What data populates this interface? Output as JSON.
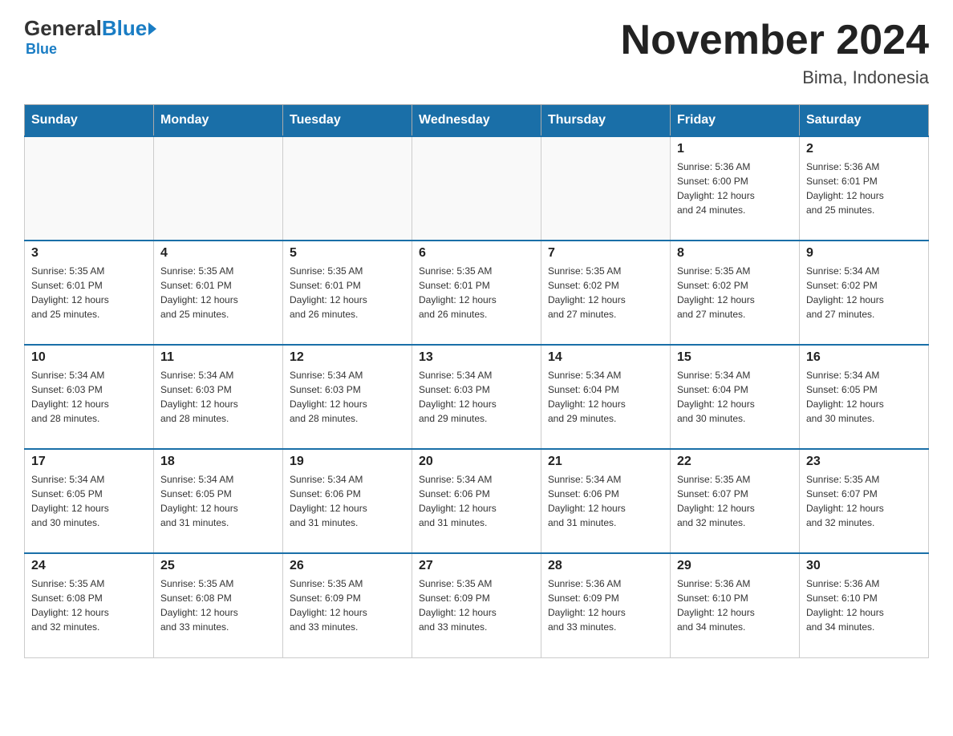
{
  "header": {
    "logo_general": "General",
    "logo_blue": "Blue",
    "title": "November 2024",
    "subtitle": "Bima, Indonesia"
  },
  "days_of_week": [
    "Sunday",
    "Monday",
    "Tuesday",
    "Wednesday",
    "Thursday",
    "Friday",
    "Saturday"
  ],
  "weeks": [
    [
      {
        "day": "",
        "info": ""
      },
      {
        "day": "",
        "info": ""
      },
      {
        "day": "",
        "info": ""
      },
      {
        "day": "",
        "info": ""
      },
      {
        "day": "",
        "info": ""
      },
      {
        "day": "1",
        "info": "Sunrise: 5:36 AM\nSunset: 6:00 PM\nDaylight: 12 hours\nand 24 minutes."
      },
      {
        "day": "2",
        "info": "Sunrise: 5:36 AM\nSunset: 6:01 PM\nDaylight: 12 hours\nand 25 minutes."
      }
    ],
    [
      {
        "day": "3",
        "info": "Sunrise: 5:35 AM\nSunset: 6:01 PM\nDaylight: 12 hours\nand 25 minutes."
      },
      {
        "day": "4",
        "info": "Sunrise: 5:35 AM\nSunset: 6:01 PM\nDaylight: 12 hours\nand 25 minutes."
      },
      {
        "day": "5",
        "info": "Sunrise: 5:35 AM\nSunset: 6:01 PM\nDaylight: 12 hours\nand 26 minutes."
      },
      {
        "day": "6",
        "info": "Sunrise: 5:35 AM\nSunset: 6:01 PM\nDaylight: 12 hours\nand 26 minutes."
      },
      {
        "day": "7",
        "info": "Sunrise: 5:35 AM\nSunset: 6:02 PM\nDaylight: 12 hours\nand 27 minutes."
      },
      {
        "day": "8",
        "info": "Sunrise: 5:35 AM\nSunset: 6:02 PM\nDaylight: 12 hours\nand 27 minutes."
      },
      {
        "day": "9",
        "info": "Sunrise: 5:34 AM\nSunset: 6:02 PM\nDaylight: 12 hours\nand 27 minutes."
      }
    ],
    [
      {
        "day": "10",
        "info": "Sunrise: 5:34 AM\nSunset: 6:03 PM\nDaylight: 12 hours\nand 28 minutes."
      },
      {
        "day": "11",
        "info": "Sunrise: 5:34 AM\nSunset: 6:03 PM\nDaylight: 12 hours\nand 28 minutes."
      },
      {
        "day": "12",
        "info": "Sunrise: 5:34 AM\nSunset: 6:03 PM\nDaylight: 12 hours\nand 28 minutes."
      },
      {
        "day": "13",
        "info": "Sunrise: 5:34 AM\nSunset: 6:03 PM\nDaylight: 12 hours\nand 29 minutes."
      },
      {
        "day": "14",
        "info": "Sunrise: 5:34 AM\nSunset: 6:04 PM\nDaylight: 12 hours\nand 29 minutes."
      },
      {
        "day": "15",
        "info": "Sunrise: 5:34 AM\nSunset: 6:04 PM\nDaylight: 12 hours\nand 30 minutes."
      },
      {
        "day": "16",
        "info": "Sunrise: 5:34 AM\nSunset: 6:05 PM\nDaylight: 12 hours\nand 30 minutes."
      }
    ],
    [
      {
        "day": "17",
        "info": "Sunrise: 5:34 AM\nSunset: 6:05 PM\nDaylight: 12 hours\nand 30 minutes."
      },
      {
        "day": "18",
        "info": "Sunrise: 5:34 AM\nSunset: 6:05 PM\nDaylight: 12 hours\nand 31 minutes."
      },
      {
        "day": "19",
        "info": "Sunrise: 5:34 AM\nSunset: 6:06 PM\nDaylight: 12 hours\nand 31 minutes."
      },
      {
        "day": "20",
        "info": "Sunrise: 5:34 AM\nSunset: 6:06 PM\nDaylight: 12 hours\nand 31 minutes."
      },
      {
        "day": "21",
        "info": "Sunrise: 5:34 AM\nSunset: 6:06 PM\nDaylight: 12 hours\nand 31 minutes."
      },
      {
        "day": "22",
        "info": "Sunrise: 5:35 AM\nSunset: 6:07 PM\nDaylight: 12 hours\nand 32 minutes."
      },
      {
        "day": "23",
        "info": "Sunrise: 5:35 AM\nSunset: 6:07 PM\nDaylight: 12 hours\nand 32 minutes."
      }
    ],
    [
      {
        "day": "24",
        "info": "Sunrise: 5:35 AM\nSunset: 6:08 PM\nDaylight: 12 hours\nand 32 minutes."
      },
      {
        "day": "25",
        "info": "Sunrise: 5:35 AM\nSunset: 6:08 PM\nDaylight: 12 hours\nand 33 minutes."
      },
      {
        "day": "26",
        "info": "Sunrise: 5:35 AM\nSunset: 6:09 PM\nDaylight: 12 hours\nand 33 minutes."
      },
      {
        "day": "27",
        "info": "Sunrise: 5:35 AM\nSunset: 6:09 PM\nDaylight: 12 hours\nand 33 minutes."
      },
      {
        "day": "28",
        "info": "Sunrise: 5:36 AM\nSunset: 6:09 PM\nDaylight: 12 hours\nand 33 minutes."
      },
      {
        "day": "29",
        "info": "Sunrise: 5:36 AM\nSunset: 6:10 PM\nDaylight: 12 hours\nand 34 minutes."
      },
      {
        "day": "30",
        "info": "Sunrise: 5:36 AM\nSunset: 6:10 PM\nDaylight: 12 hours\nand 34 minutes."
      }
    ]
  ]
}
